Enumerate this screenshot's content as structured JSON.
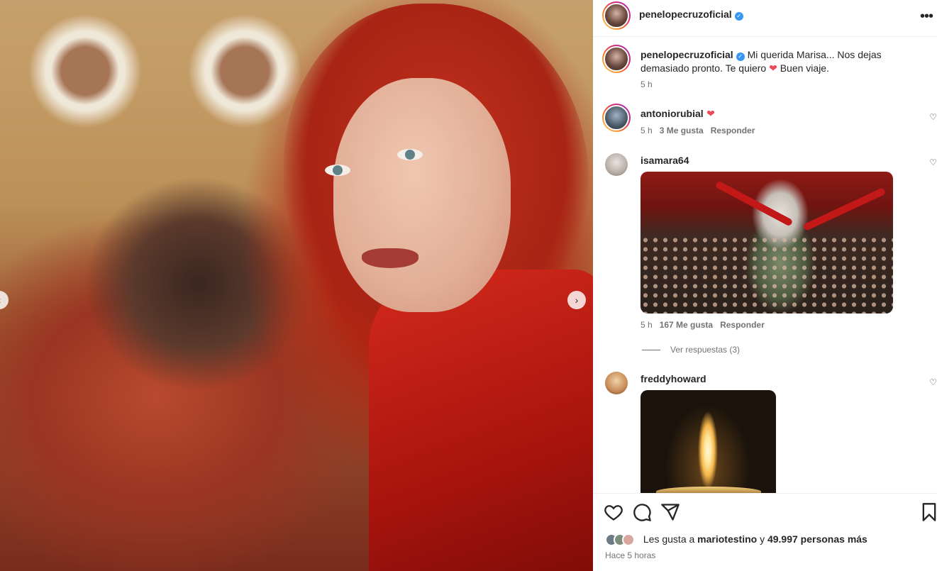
{
  "post": {
    "author": "penelopecruzoficial",
    "more_icon": "more-horizontal-icon",
    "caption": "Mi querida Marisa... Nos dejas demasiado pronto. Te quiero",
    "caption_end": "Buen viaje.",
    "caption_time": "5 h"
  },
  "media": {
    "next_icon": "chevron-right-icon",
    "prev_icon": "chevron-left-icon"
  },
  "comments": [
    {
      "user": "antoniorubial",
      "text_icon": "red-heart-emoji",
      "time": "5 h",
      "likes": "3 Me gusta",
      "reply": "Responder"
    },
    {
      "user": "isamara64",
      "attachment": "theater-gif",
      "time": "5 h",
      "likes": "167 Me gusta",
      "reply": "Responder",
      "view_replies": "Ver respuestas (3)"
    },
    {
      "user": "freddyhoward",
      "attachment": "candle-gif"
    }
  ],
  "footer": {
    "likes_prefix": "Les gusta a",
    "liker": "mariotestino",
    "likes_connector": "y",
    "likes_rest": "49.997 personas más",
    "posted": "Hace 5 horas"
  },
  "colors": {
    "verified": "#3897f0",
    "heart": "#ed4956",
    "text": "#262626",
    "muted": "#737373"
  }
}
